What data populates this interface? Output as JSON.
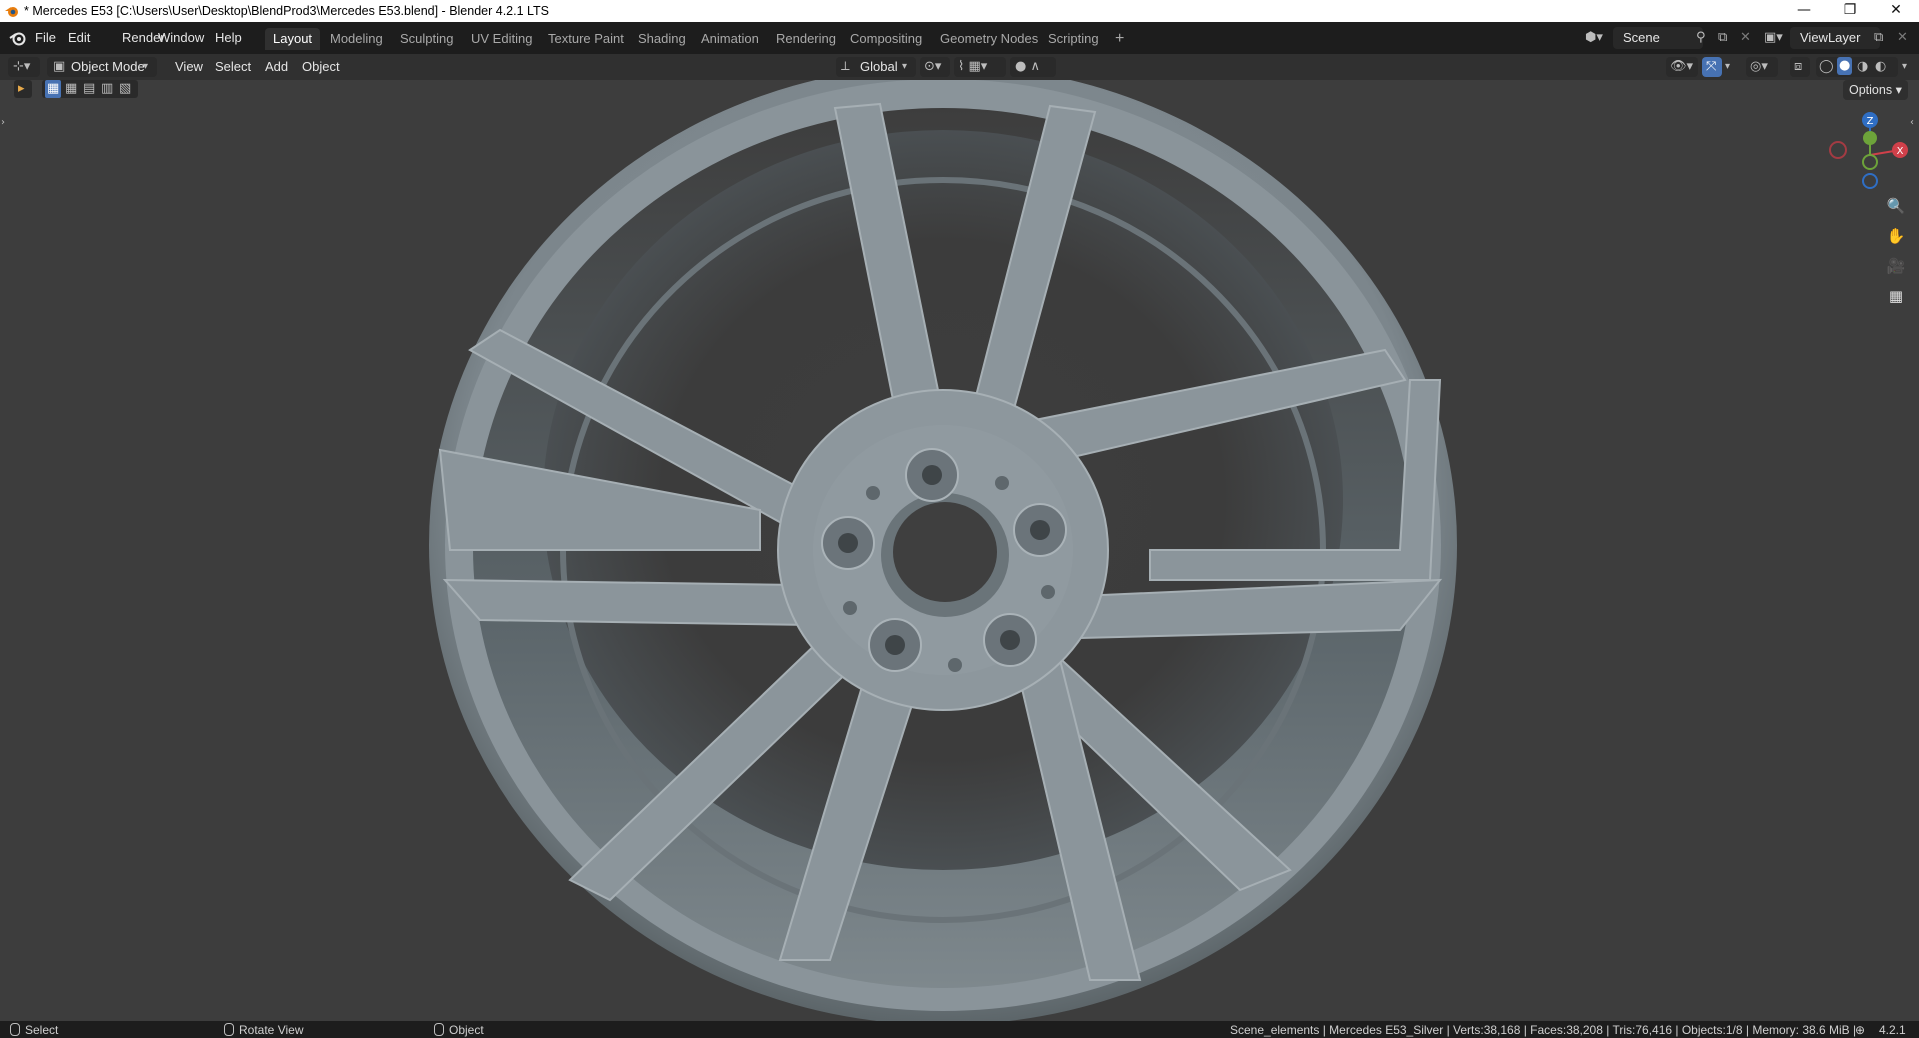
{
  "window": {
    "title": "* Mercedes E53 [C:\\Users\\User\\Desktop\\BlendProd3\\Mercedes E53.blend] - Blender 4.2.1 LTS",
    "minimize": "—",
    "restore": "❐",
    "close": "✕"
  },
  "menus": [
    "File",
    "Edit",
    "Render",
    "Window",
    "Help"
  ],
  "workspaces": {
    "active": "Layout",
    "tabs": [
      "Layout",
      "Modeling",
      "Sculpting",
      "UV Editing",
      "Texture Paint",
      "Shading",
      "Animation",
      "Rendering",
      "Compositing",
      "Geometry Nodes",
      "Scripting"
    ],
    "add": "+"
  },
  "scene": {
    "name": "Scene"
  },
  "view_layer": {
    "name": "ViewLayer"
  },
  "viewport_header": {
    "mode": "Object Mode",
    "menus": [
      "View",
      "Select",
      "Add",
      "Object"
    ],
    "orientation": "Global"
  },
  "options_label": "Options",
  "gizmo": {
    "z": "Z",
    "x": "X",
    "y": "Y"
  },
  "statusbar": {
    "left": [
      "Select",
      "Rotate View",
      "Object"
    ],
    "stats": "Scene_elements | Mercedes E53_Silver | Verts:38,168 | Faces:38,208 | Tris:76,416 | Objects:1/8 | Memory: 38.6 MiB |",
    "version": "4.2.1"
  },
  "colors": {
    "topbar": "#1d1d1d",
    "header": "#303030",
    "viewport": "#3d3d3d",
    "accent": "#4772b3",
    "wheel": "#8c969c"
  }
}
